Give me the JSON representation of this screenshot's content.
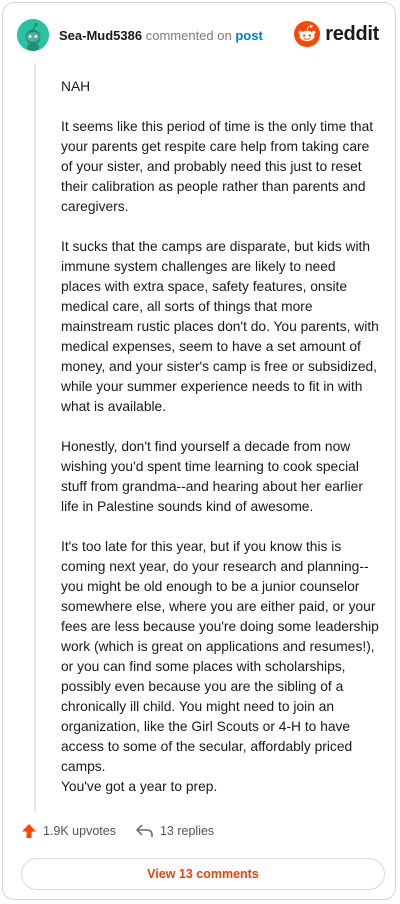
{
  "header": {
    "username": "Sea-Mud5386",
    "commented_on": "commented on",
    "post_link": "post",
    "brand": "reddit"
  },
  "comment": {
    "paragraphs": [
      "NAH",
      "It seems like this period of time is the only time that your parents get respite care help from taking care of your sister, and probably need this just to reset their calibration as people rather than parents and caregivers.",
      "It sucks that the camps are disparate, but kids with immune system challenges are likely to need places with extra space, safety features, onsite medical care, all sorts of things that more mainstream rustic places don't do. You parents, with medical expenses, seem to have a set amount of money, and your sister's camp is free or subsidized, while your summer experience needs to fit in with what is available.",
      "Honestly, don't find yourself a decade from now wishing you'd spent time learning to cook special stuff from grandma--and hearing about her earlier life in Palestine sounds kind of awesome.",
      "It's too late for this year, but if you know this is coming next year, do your research and planning--you might be old enough to be a junior counselor somewhere else, where you are either paid, or your fees are less because you're doing some leadership work (which is great on applications and resumes!), or you can find some places with scholarships, possibly even because you are the sibling of a chronically ill child. You might need to join an organization, like the Girl Scouts or 4-H to have access to some of the secular, affordably priced camps.",
      "You've got a year to prep."
    ]
  },
  "actions": {
    "upvotes": "1.9K upvotes",
    "replies": "13 replies",
    "view_comments": "View 13 comments"
  },
  "colors": {
    "accent": "#ff4500",
    "link": "#0079d3",
    "avatar_bg": "#27c3a3"
  }
}
